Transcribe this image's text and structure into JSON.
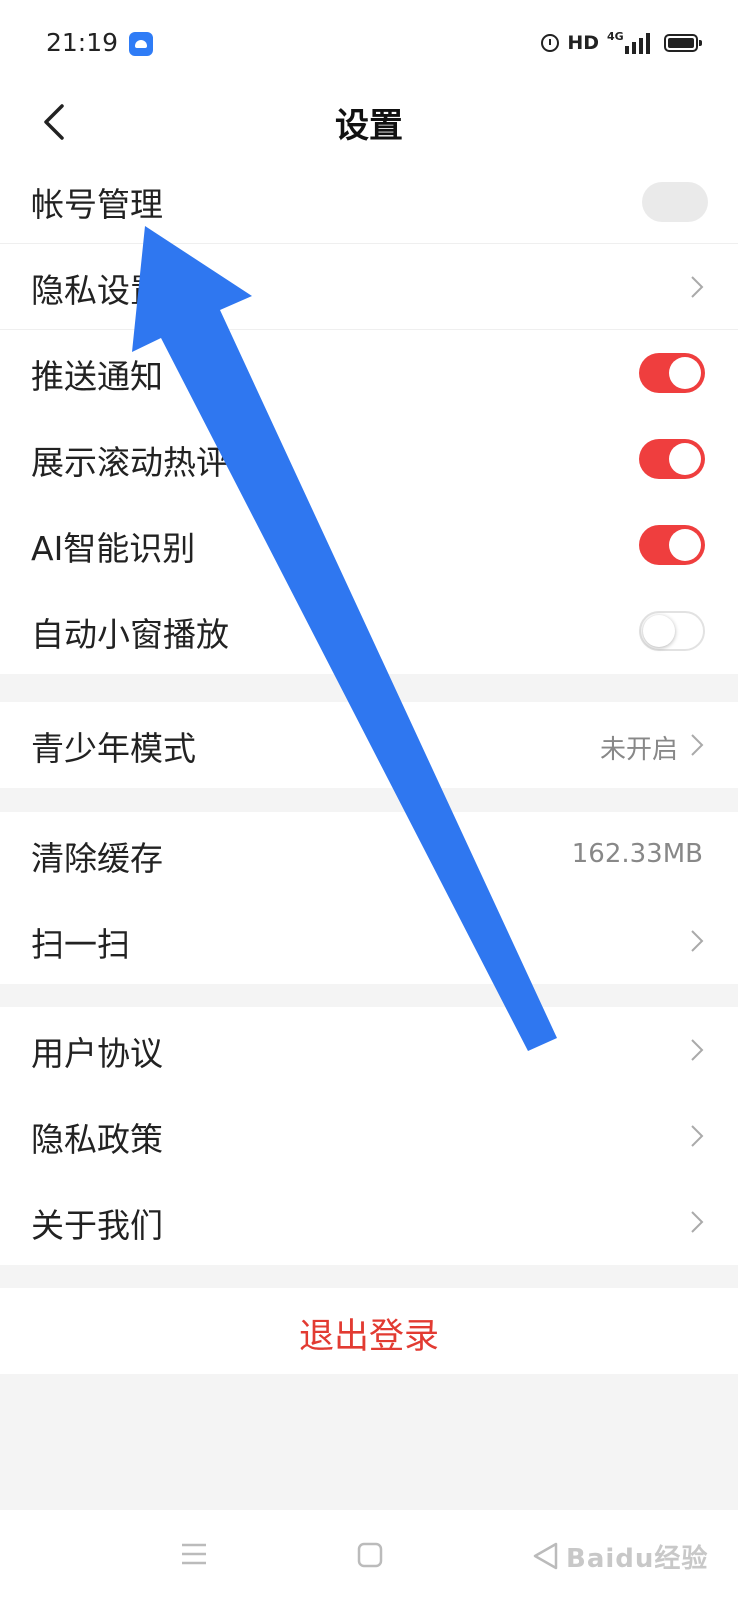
{
  "status_bar": {
    "time": "21:19",
    "indicators": [
      "alarm-icon",
      "HD",
      "4G signal",
      "battery-icon"
    ],
    "hd": "HD",
    "network": "4G"
  },
  "header": {
    "title": "设置",
    "back_icon": "chevron-left-icon"
  },
  "groups": [
    {
      "items": [
        {
          "label": "帐号管理",
          "control": "blurred-avatar"
        },
        {
          "label": "隐私设置",
          "control": "chevron"
        },
        {
          "label": "推送通知",
          "control": "toggle",
          "on": true
        },
        {
          "label": "展示滚动热评",
          "control": "toggle",
          "on": true
        },
        {
          "label": "AI智能识别",
          "control": "toggle",
          "on": true
        },
        {
          "label": "自动小窗播放",
          "control": "toggle",
          "on": false
        }
      ]
    },
    {
      "items": [
        {
          "label": "青少年模式",
          "value": "未开启",
          "control": "chevron"
        }
      ]
    },
    {
      "items": [
        {
          "label": "清除缓存",
          "value": "162.33MB",
          "control": "none"
        },
        {
          "label": "扫一扫",
          "control": "chevron"
        }
      ]
    },
    {
      "items": [
        {
          "label": "用户协议",
          "control": "chevron"
        },
        {
          "label": "隐私政策",
          "control": "chevron"
        },
        {
          "label": "关于我们",
          "control": "chevron"
        }
      ]
    }
  ],
  "logout_label": "退出登录",
  "bottom_nav": {
    "icons": [
      "menu-icon",
      "home-icon",
      "back-icon"
    ]
  },
  "watermark": "Baidu经验",
  "colors": {
    "accent_red": "#ef3e3e",
    "logout_red": "#e23b32",
    "arrow_blue": "#2f77f0"
  }
}
